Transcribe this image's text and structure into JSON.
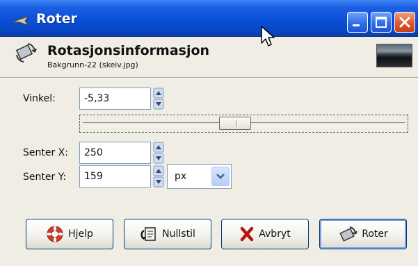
{
  "window": {
    "title": "Roter"
  },
  "header": {
    "title": "Rotasjonsinformasjon",
    "subtitle": "Bakgrunn-22 (skeiv.jpg)"
  },
  "fields": {
    "angle_label": "Vinkel:",
    "angle_value": "-5,33",
    "angle_slider_fraction": 0.47,
    "center_x_label": "Senter X:",
    "center_x_value": "250",
    "center_y_label": "Senter Y:",
    "center_y_value": "159",
    "unit_value": "px"
  },
  "buttons": {
    "help": "Hjelp",
    "reset": "Nullstil",
    "cancel": "Avbryt",
    "rotate": "Roter"
  },
  "colors": {
    "titlebar": "#0a4fd8",
    "dialog_bg": "#efede4",
    "close_button": "#e0582e"
  },
  "icons": {
    "titlebar": "rotate-app-icon",
    "header": "rotate-tool-icon",
    "help": "lifebuoy-icon",
    "reset": "reset-icon",
    "cancel": "x-icon",
    "rotate": "rotate-icon"
  }
}
